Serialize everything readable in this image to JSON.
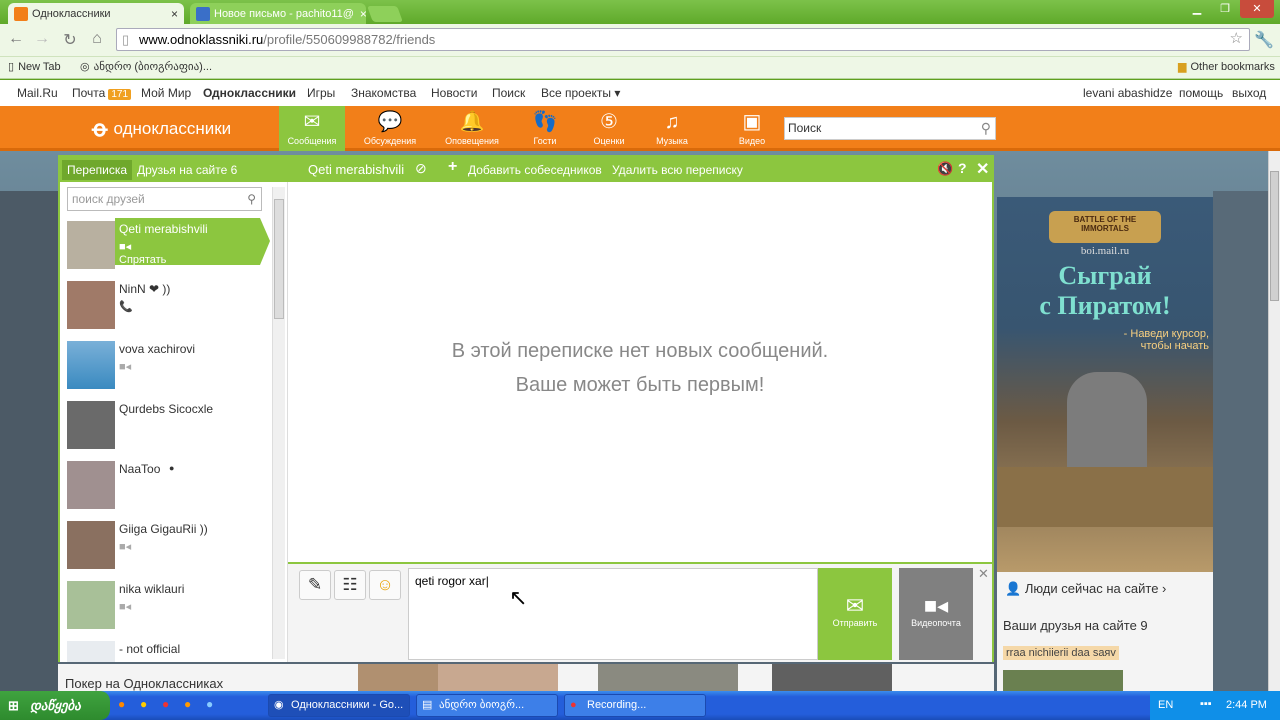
{
  "browser": {
    "tabs": [
      {
        "title": "Одноклассники",
        "active": true
      },
      {
        "title": "Новое письмо - pachito11@",
        "active": false
      }
    ],
    "url_host": "www.odnoklassniki.ru",
    "url_path": "/profile/550609988782/friends",
    "bookmarks": {
      "new_tab": "New Tab",
      "item2": "ანდრო (ბიოგრაფია)...",
      "other": "Other bookmarks"
    }
  },
  "sitebar": {
    "links": [
      "Mail.Ru",
      "Почта",
      "Мой Мир",
      "Одноклассники",
      "Игры",
      "Знакомства",
      "Новости",
      "Поиск",
      "Все проекты ▾"
    ],
    "mail_count": "171",
    "user": "levani abashidze",
    "help": "помощь",
    "logout": "выход"
  },
  "header": {
    "logo": "одноклассники",
    "nav": [
      "Сообщения",
      "Обсуждения",
      "Оповещения",
      "Гости",
      "Оценки",
      "Музыка",
      "Видео"
    ],
    "search_placeholder": "Поиск"
  },
  "chat": {
    "tab_convo": "Переписка",
    "tab_friends": "Друзья на сайте 6",
    "current": "Qeti merabishvili",
    "add": "Добавить собеседников",
    "delete_all": "Удалить всю переписку",
    "search_placeholder": "поиск друзей",
    "hide": "Спрятать",
    "contacts": [
      {
        "name": "Qeti merabishvili"
      },
      {
        "name": "NinN ❤ ))"
      },
      {
        "name": "vova xachirovi"
      },
      {
        "name": "Qurdebs Sicocxle"
      },
      {
        "name": "NaaToo"
      },
      {
        "name": "Giiga GigauRii ))"
      },
      {
        "name": "nika wiklauri"
      },
      {
        "name": "- not official"
      }
    ],
    "empty_line1": "В этой переписке нет новых сообщений.",
    "empty_line2": "Ваше может быть первым!",
    "message": "qeti rogor xar",
    "send": "Отправить",
    "videomail": "Видеопочта"
  },
  "right": {
    "ad_site": "boi.mail.ru",
    "ad_title1": "Сыграй",
    "ad_title2": "с Пиратом!",
    "ad_sub": "- Наведи курсор, чтобы начать",
    "ad_logo": "BATTLE OF THE IMMORTALS",
    "people": "Люди сейчас на сайте ›",
    "friends_online": "Ваши друзья на сайте 9",
    "friend_tag": "rraa nichiierii daa saяv"
  },
  "bottom": {
    "poker": "Покер на Одноклассниках"
  },
  "taskbar": {
    "start": "დაწყება",
    "tasks": [
      "Одноклассники - Go...",
      "ანდრო ბიოგრ...",
      "Recording..."
    ],
    "lang": "EN",
    "time": "2:44 PM"
  }
}
